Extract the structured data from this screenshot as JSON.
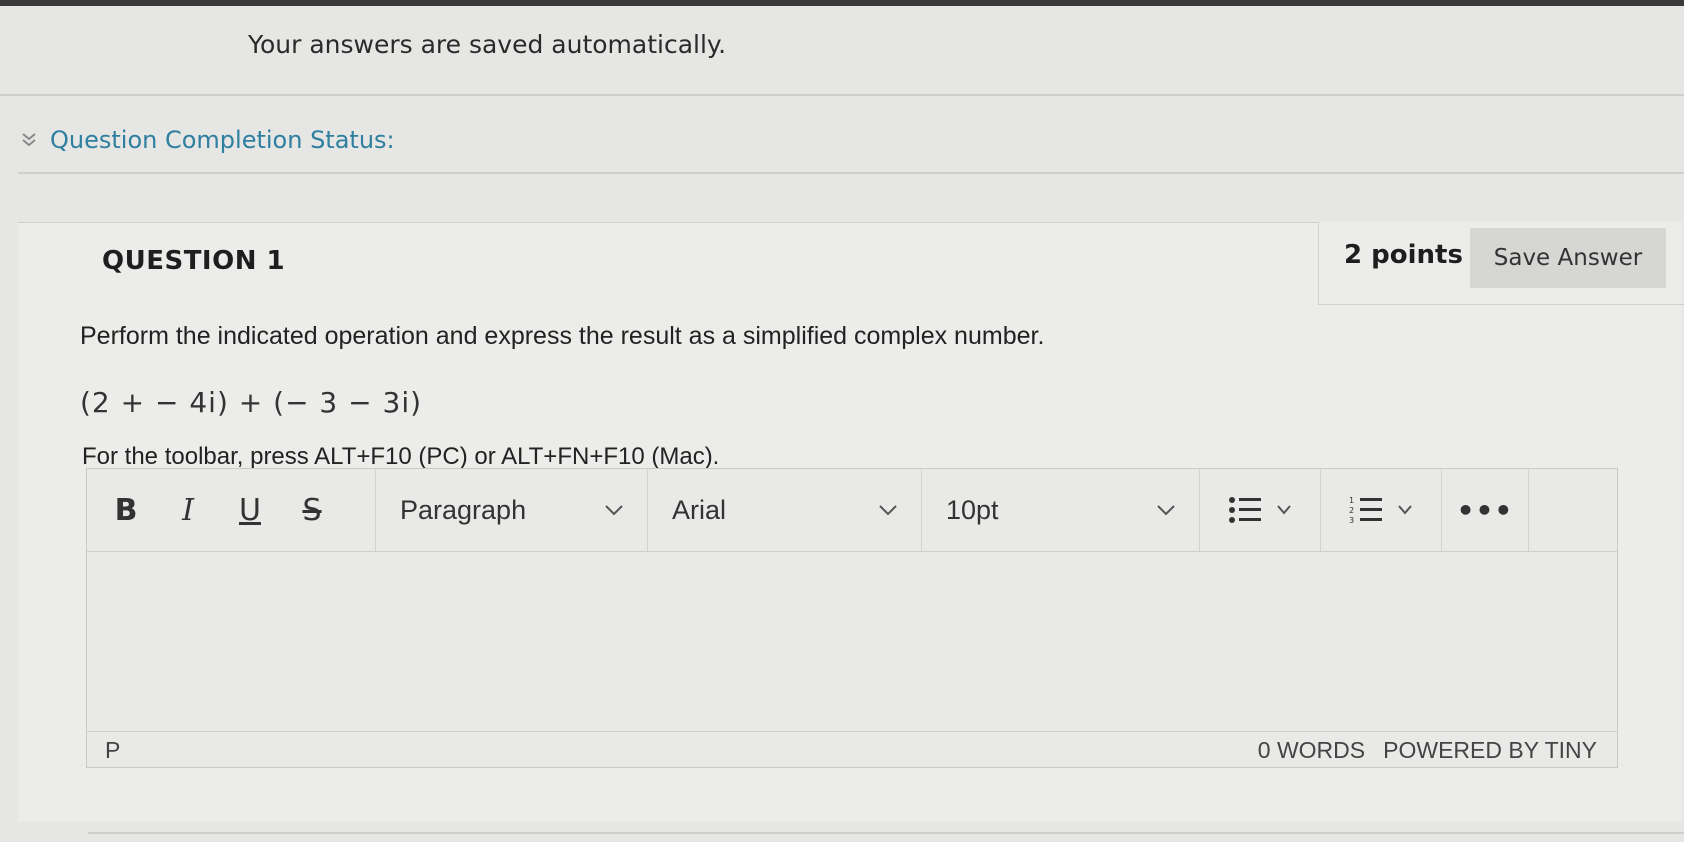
{
  "header": {
    "saved_note": "Your answers are saved automatically."
  },
  "completion": {
    "label": "Question Completion Status:",
    "icon": "double-chevron-down-icon"
  },
  "question": {
    "title": "QUESTION 1",
    "points": "2 points",
    "save_label": "Save Answer",
    "prompt": "Perform the indicated operation and express the result as a simplified complex number.",
    "expression": "(2 + − 4i) + (− 3 − 3i)",
    "toolbar_hint": "For the toolbar, press ALT+F10 (PC) or ALT+FN+F10 (Mac)."
  },
  "editor": {
    "bold": "B",
    "italic": "I",
    "underline": "U",
    "strike": "S",
    "block_format": "Paragraph",
    "font_family": "Arial",
    "font_size": "10pt",
    "more": "•••",
    "path": "P",
    "word_count": "0 WORDS",
    "powered_by": "POWERED BY TINY",
    "content": ""
  },
  "colors": {
    "background": "#e6e6e4",
    "accent_link": "#2f7fa0",
    "button": "#d6d6d4"
  }
}
